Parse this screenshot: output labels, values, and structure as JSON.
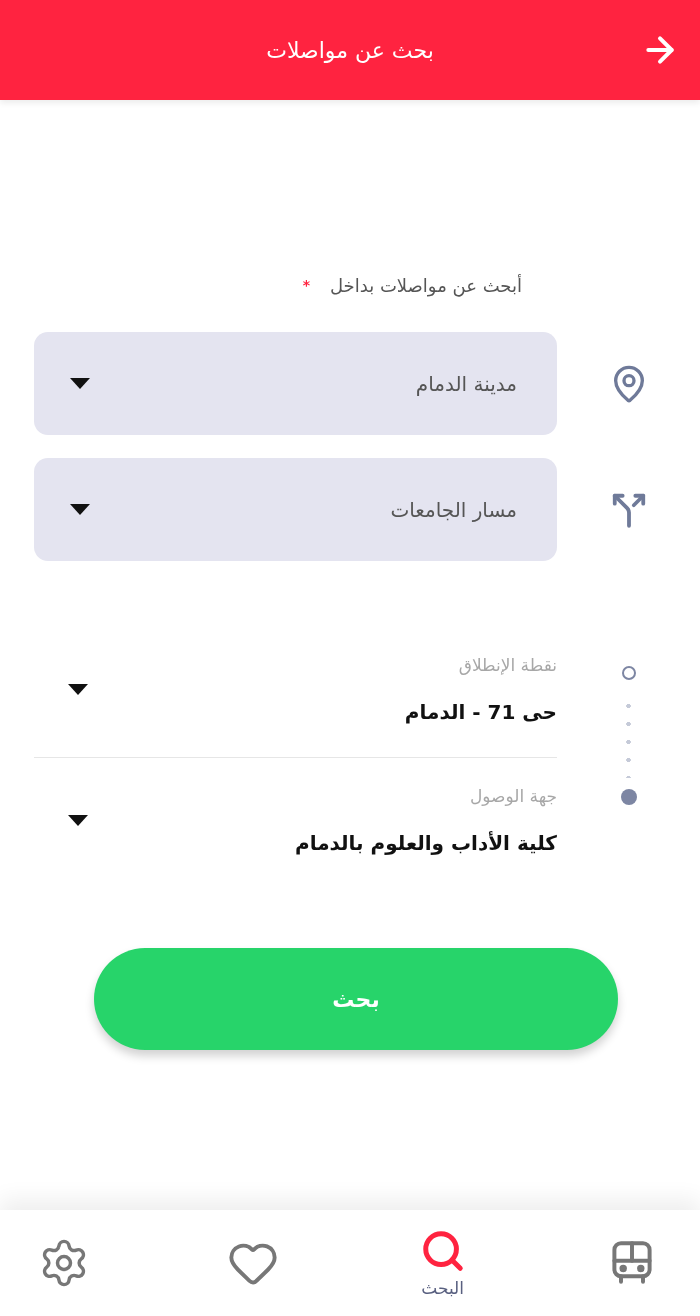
{
  "header": {
    "title": "بحث عن مواصلات"
  },
  "filter": {
    "label": "أبحث عن مواصلات بداخل",
    "required_mark": "*"
  },
  "selects": [
    {
      "kind": "city",
      "value": "مدينة الدمام"
    },
    {
      "kind": "route",
      "value": "مسار الجامعات"
    }
  ],
  "trip": [
    {
      "kind": "origin",
      "label": "نقطة الإنطلاق",
      "value": "حى 71 - الدمام"
    },
    {
      "kind": "destination",
      "label": "جهة الوصول",
      "value": "كلية الأداب والعلوم بالدمام"
    }
  ],
  "search_button": {
    "label": "بحث"
  },
  "bottom_nav": [
    {
      "kind": "bus",
      "selected": false
    },
    {
      "kind": "search",
      "label": "البحث",
      "selected": true
    },
    {
      "kind": "favorites",
      "selected": false
    },
    {
      "kind": "settings",
      "selected": false
    }
  ]
}
